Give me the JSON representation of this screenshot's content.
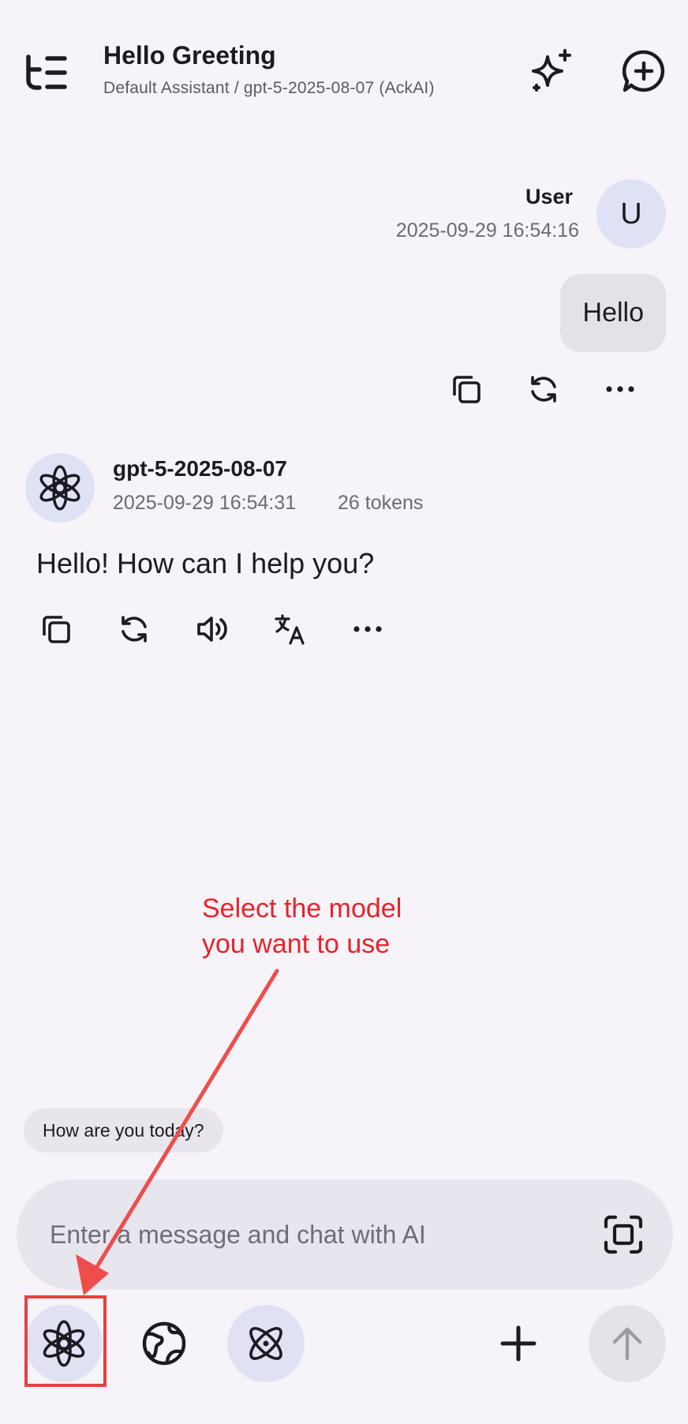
{
  "header": {
    "title": "Hello Greeting",
    "subtitle": "Default Assistant / gpt-5-2025-08-07 (AckAI)"
  },
  "user_message": {
    "author": "User",
    "avatar_letter": "U",
    "timestamp": "2025-09-29 16:54:16",
    "text": "Hello"
  },
  "assistant_message": {
    "model": "gpt-5-2025-08-07",
    "timestamp": "2025-09-29 16:54:31",
    "tokens": "26 tokens",
    "text": "Hello! How can I help you?"
  },
  "annotation": {
    "line1": "Select the model",
    "line2": "you want to use",
    "color": "#e8222b"
  },
  "suggestion": "How are you today?",
  "composer": {
    "placeholder": "Enter a message and chat with AI"
  },
  "icons": {
    "menu": "menu-icon",
    "sparkle": "sparkle-icon",
    "new_chat": "new-chat-icon",
    "copy": "copy-icon",
    "regenerate": "refresh-icon",
    "more": "more-icon",
    "speaker": "speaker-icon",
    "translate": "translate-icon",
    "model": "openai-icon",
    "web": "globe-icon",
    "reasoning": "atom-icon",
    "scan": "scan-icon",
    "add": "plus-icon",
    "send": "arrow-up-icon"
  },
  "colors": {
    "background": "#f6f4f9",
    "avatar_bg": "#dfe2f5",
    "accent_red": "#e8403f"
  }
}
